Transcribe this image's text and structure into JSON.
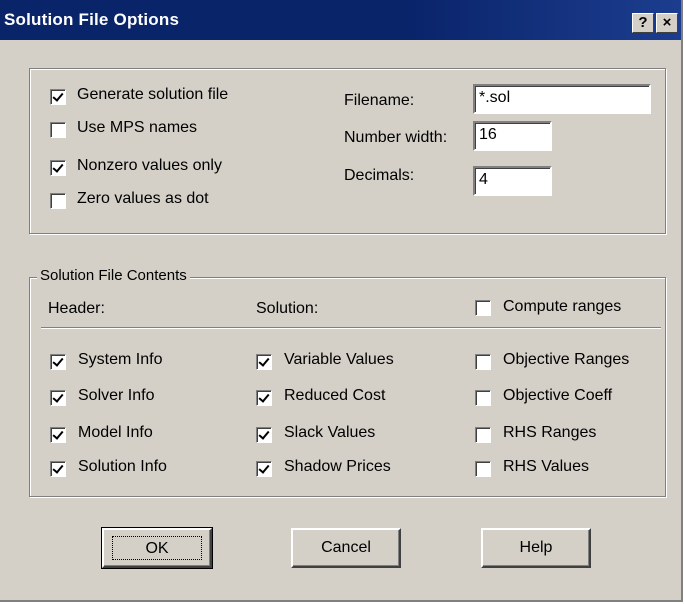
{
  "window": {
    "title": "Solution File Options",
    "help_glyph": "?",
    "close_glyph": "×"
  },
  "options": {
    "generate_solution_file": {
      "label": "Generate solution file",
      "checked": true
    },
    "use_mps_names": {
      "label": "Use MPS names",
      "checked": false
    },
    "nonzero_values_only": {
      "label": "Nonzero values only",
      "checked": true
    },
    "zero_values_as_dot": {
      "label": "Zero values as dot",
      "checked": false
    }
  },
  "fields": {
    "filename": {
      "label": "Filename:",
      "value": "*.sol"
    },
    "number_width": {
      "label": "Number width:",
      "value": "16"
    },
    "decimals": {
      "label": "Decimals:",
      "value": "4"
    }
  },
  "contents": {
    "legend": "Solution File Contents",
    "header_label": "Header:",
    "solution_label": "Solution:",
    "compute_ranges": {
      "label": "Compute ranges",
      "checked": false
    },
    "header_items": [
      {
        "label": "System Info",
        "checked": true
      },
      {
        "label": "Solver Info",
        "checked": true
      },
      {
        "label": "Model Info",
        "checked": true
      },
      {
        "label": "Solution Info",
        "checked": true
      }
    ],
    "solution_items": [
      {
        "label": "Variable Values",
        "checked": true
      },
      {
        "label": "Reduced Cost",
        "checked": true
      },
      {
        "label": "Slack Values",
        "checked": true
      },
      {
        "label": "Shadow Prices",
        "checked": true
      }
    ],
    "range_items": [
      {
        "label": "Objective Ranges",
        "checked": false
      },
      {
        "label": "Objective Coeff",
        "checked": false
      },
      {
        "label": "RHS Ranges",
        "checked": false
      },
      {
        "label": "RHS Values",
        "checked": false
      }
    ]
  },
  "buttons": {
    "ok": "OK",
    "cancel": "Cancel",
    "help": "Help"
  }
}
